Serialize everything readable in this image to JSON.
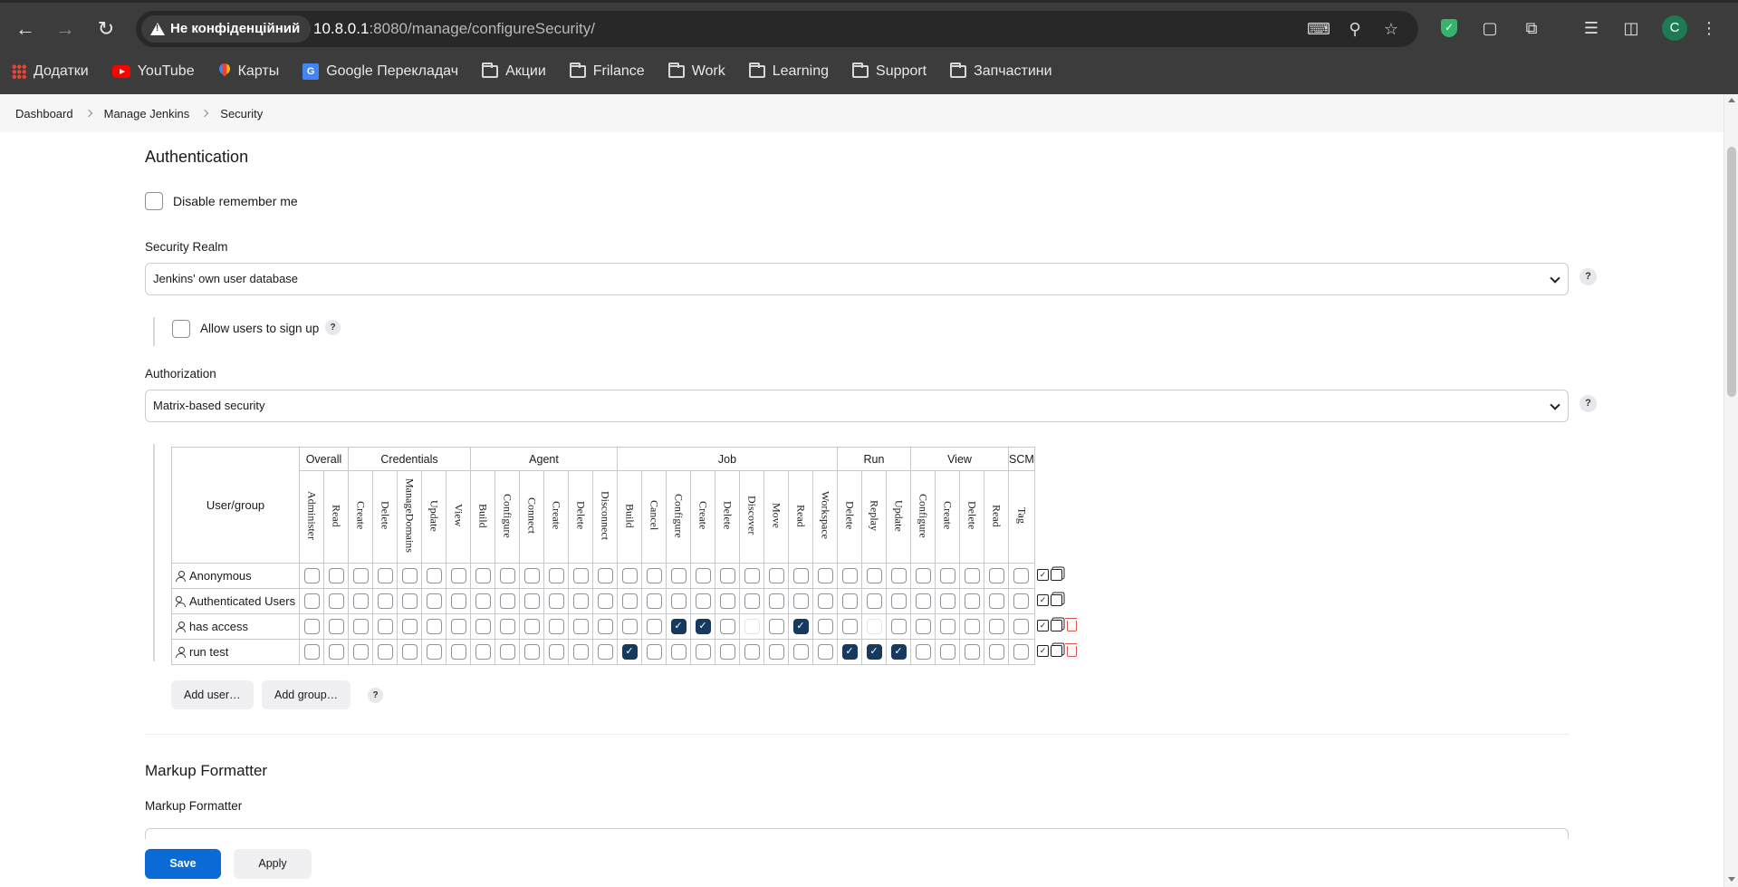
{
  "browser": {
    "security_chip": "Не конфіденційний",
    "url_host": "10.8.0.1",
    "url_rest": ":8080/manage/configureSecurity/",
    "profile_initial": "C",
    "bookmarks": [
      {
        "label": "Додатки",
        "icon": "apps-grid-icon"
      },
      {
        "label": "YouTube",
        "icon": "youtube-icon"
      },
      {
        "label": "Карты",
        "icon": "maps-icon"
      },
      {
        "label": "Google Перекладач",
        "icon": "google-translate-icon"
      },
      {
        "label": "Акции",
        "icon": "folder-icon"
      },
      {
        "label": "Frilance",
        "icon": "folder-icon"
      },
      {
        "label": "Work",
        "icon": "folder-icon"
      },
      {
        "label": "Learning",
        "icon": "folder-icon"
      },
      {
        "label": "Support",
        "icon": "folder-icon"
      },
      {
        "label": "Запчастини",
        "icon": "folder-icon"
      }
    ]
  },
  "breadcrumb": [
    "Dashboard",
    "Manage Jenkins",
    "Security"
  ],
  "authentication": {
    "title": "Authentication",
    "disable_remember_me": "Disable remember me",
    "security_realm_label": "Security Realm",
    "security_realm_value": "Jenkins' own user database",
    "allow_signup": "Allow users to sign up"
  },
  "authorization": {
    "label": "Authorization",
    "value": "Matrix-based security",
    "user_group_header": "User/group",
    "groups": [
      {
        "name": "Overall",
        "perms": [
          "Administer",
          "Read"
        ]
      },
      {
        "name": "Credentials",
        "perms": [
          "Create",
          "Delete",
          "ManageDomains",
          "Update",
          "View"
        ]
      },
      {
        "name": "Agent",
        "perms": [
          "Build",
          "Configure",
          "Connect",
          "Create",
          "Delete",
          "Disconnect"
        ]
      },
      {
        "name": "Job",
        "perms": [
          "Build",
          "Cancel",
          "Configure",
          "Create",
          "Delete",
          "Discover",
          "Move",
          "Read",
          "Workspace"
        ]
      },
      {
        "name": "Run",
        "perms": [
          "Delete",
          "Replay",
          "Update"
        ]
      },
      {
        "name": "View",
        "perms": [
          "Configure",
          "Create",
          "Delete",
          "Read"
        ]
      },
      {
        "name": "SCM",
        "perms": [
          "Tag"
        ]
      }
    ],
    "rows": [
      {
        "name": "Anonymous",
        "kind": "user",
        "deletable": false,
        "checked": [],
        "dim": []
      },
      {
        "name": "Authenticated Users",
        "kind": "group",
        "deletable": false,
        "checked": [],
        "dim": []
      },
      {
        "name": "has access",
        "kind": "user",
        "deletable": true,
        "checked": [
          15,
          16,
          20
        ],
        "dim": [
          18,
          23
        ]
      },
      {
        "name": "run test",
        "kind": "user",
        "deletable": true,
        "checked": [
          13,
          22,
          23,
          24
        ],
        "dim": []
      }
    ],
    "add_user": "Add user…",
    "add_group": "Add group…"
  },
  "markup": {
    "title": "Markup Formatter",
    "label": "Markup Formatter"
  },
  "actions": {
    "save": "Save",
    "apply": "Apply"
  },
  "help_glyph": "?"
}
